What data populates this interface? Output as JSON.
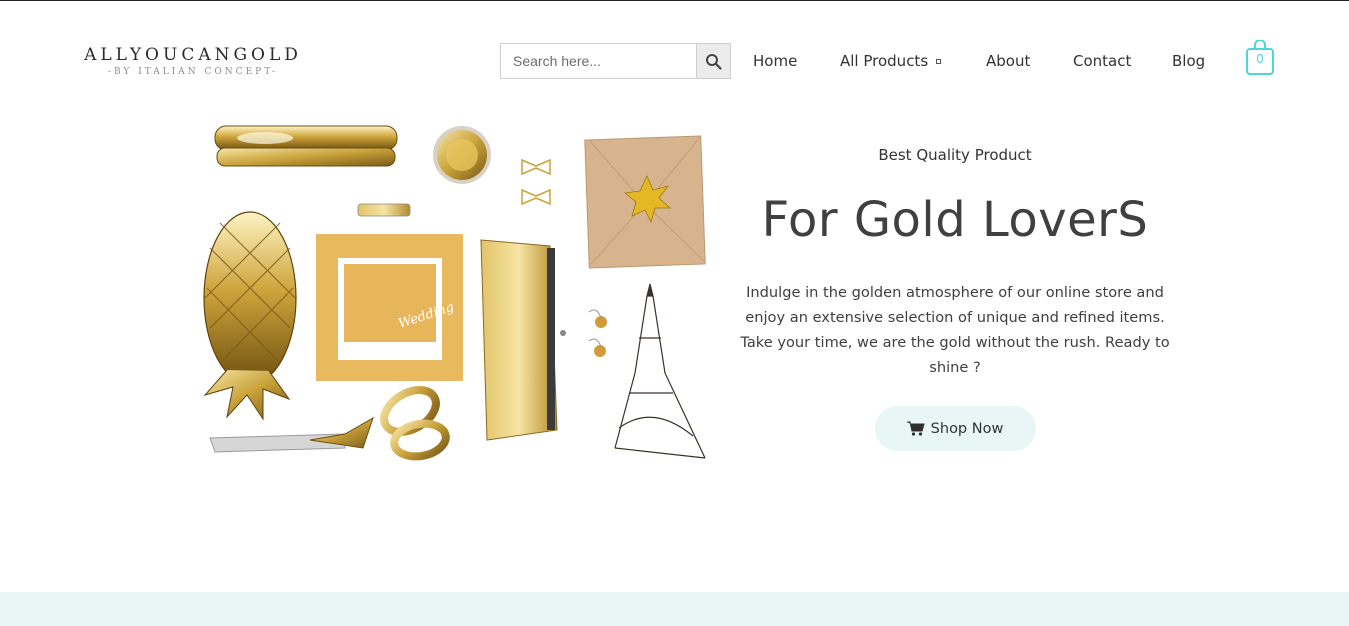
{
  "brand": {
    "name": "ALLYOUCANGOLD",
    "tagline": "-BY ITALIAN CONCEPT-"
  },
  "search": {
    "placeholder": "Search here...",
    "icon": "search-icon"
  },
  "nav": [
    {
      "label": "Home"
    },
    {
      "label": "All Products",
      "has_dropdown": true
    },
    {
      "label": "About"
    },
    {
      "label": "Contact"
    },
    {
      "label": "Blog"
    }
  ],
  "cart": {
    "count": "0",
    "icon": "shopping-bag-icon"
  },
  "hero": {
    "eyebrow": "Best Quality Product",
    "headline": "For Gold LoverS",
    "body": "Indulge in the golden atmosphere of our online store and enjoy an extensive selection of unique and refined items. Take your time, we are the gold without the rush. Ready to shine ?",
    "cta_label": "Shop Now",
    "cta_icon": "cart-icon",
    "image_text": "Wedding"
  },
  "colors": {
    "accent": "#4fd4d8",
    "cta_bg": "#e8f7f5",
    "band": "#e9f7f4",
    "gold": "#c9a23a"
  }
}
